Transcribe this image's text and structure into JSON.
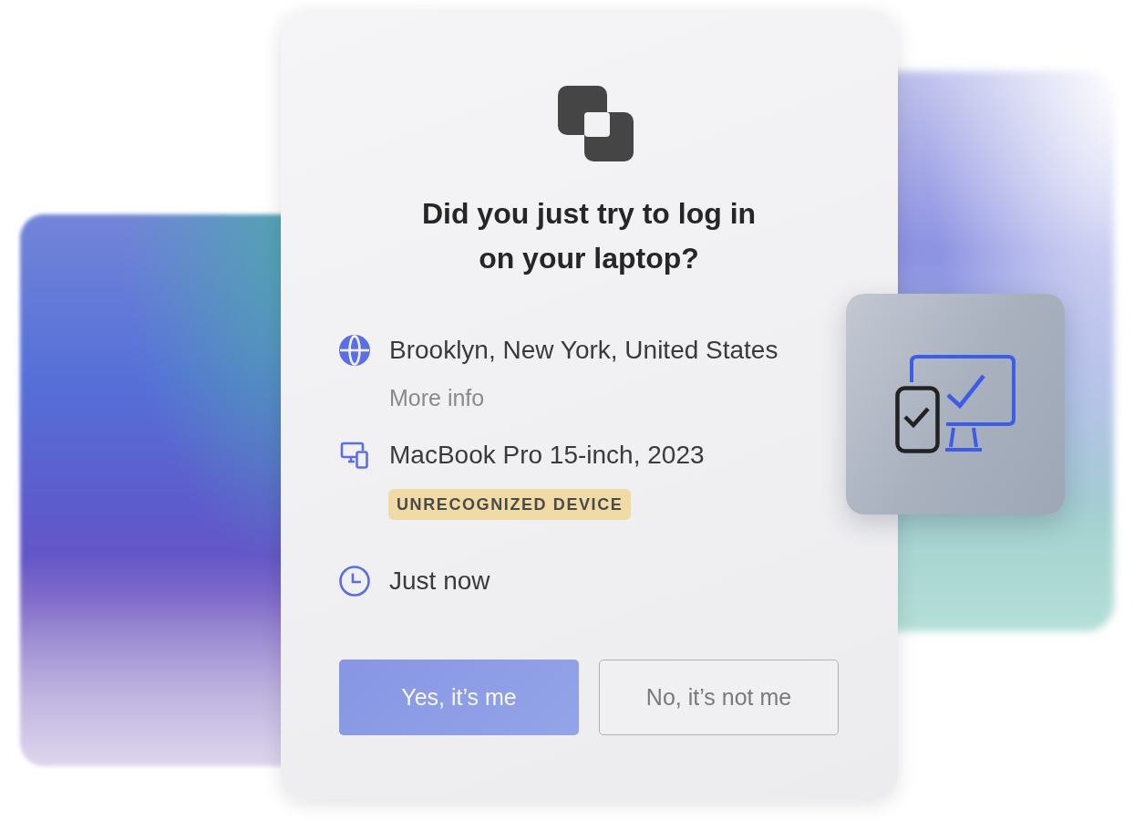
{
  "dialog": {
    "title": "Did you just try to log in on your laptop?",
    "details": [
      {
        "kind": "location",
        "text": "Brooklyn, New York, United States",
        "link": "More info"
      },
      {
        "kind": "device",
        "text": "MacBook Pro 15-inch, 2023",
        "badge": "UNRECOGNIZED DEVICE"
      },
      {
        "kind": "time",
        "text": "Just now"
      }
    ],
    "buttons": [
      {
        "kind": "primary",
        "label": "Yes, it’s me"
      },
      {
        "kind": "secondary",
        "label": "No, it’s not me"
      }
    ]
  }
}
